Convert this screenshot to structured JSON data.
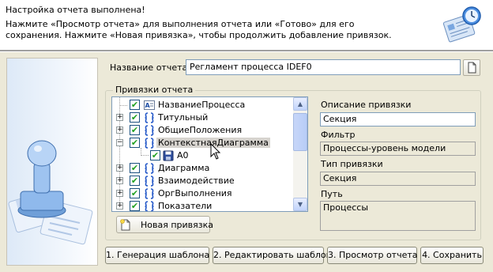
{
  "header": {
    "title": "Настройка отчета выполнена!",
    "line1": "Нажмите «Просмотр отчета»  для выполнения отчета или «Готово» для его",
    "line2": "сохранения. Нажмите «Новая привязка», чтобы продолжить добавление привязок.",
    "icon": "report-clock-icon"
  },
  "report_name": {
    "label": "Название отчета:",
    "value": "Регламент процесса IDEF0",
    "browse_icon": "document-icon"
  },
  "bindings": {
    "group_label": "Привязки отчета",
    "tree": [
      {
        "label": "НазваниеПроцесса",
        "icon": "text-field-icon",
        "checked": true,
        "expander": "none"
      },
      {
        "label": "Титульный",
        "icon": "section-icon",
        "checked": true,
        "expander": "+"
      },
      {
        "label": "ОбщиеПоложения",
        "icon": "section-icon",
        "checked": true,
        "expander": "+"
      },
      {
        "label": "КонтекстнаяДиаграмма",
        "icon": "section-icon",
        "checked": true,
        "expander": "-",
        "selected": true
      },
      {
        "label": "A0",
        "icon": "save-icon",
        "checked": true,
        "expander": "none",
        "child": true
      },
      {
        "label": "Диаграмма",
        "icon": "section-icon",
        "checked": true,
        "expander": "+"
      },
      {
        "label": "Взаимодействие",
        "icon": "section-icon",
        "checked": true,
        "expander": "+"
      },
      {
        "label": "ОргВыполнения",
        "icon": "section-icon",
        "checked": true,
        "expander": "+"
      },
      {
        "label": "Показатели",
        "icon": "section-icon",
        "checked": true,
        "expander": "+"
      }
    ],
    "new_binding_button": "Новая привязка"
  },
  "details": {
    "description_label": "Описание привязки",
    "description_value": "Секция",
    "filter_label": "Фильтр",
    "filter_value": "Процессы-уровень модели",
    "type_label": "Тип привязки",
    "type_value": "Секция",
    "path_label": "Путь",
    "path_value": "Процессы"
  },
  "footer": {
    "btn1": "1. Генерация шаблона",
    "btn2": "2. Редактировать шаблон",
    "btn3": "3. Просмотр отчета",
    "btn4": "4. Сохранить"
  },
  "colors": {
    "selection": "#d6d3ce",
    "check": "#21a121",
    "section_icon": "#2458c8"
  }
}
